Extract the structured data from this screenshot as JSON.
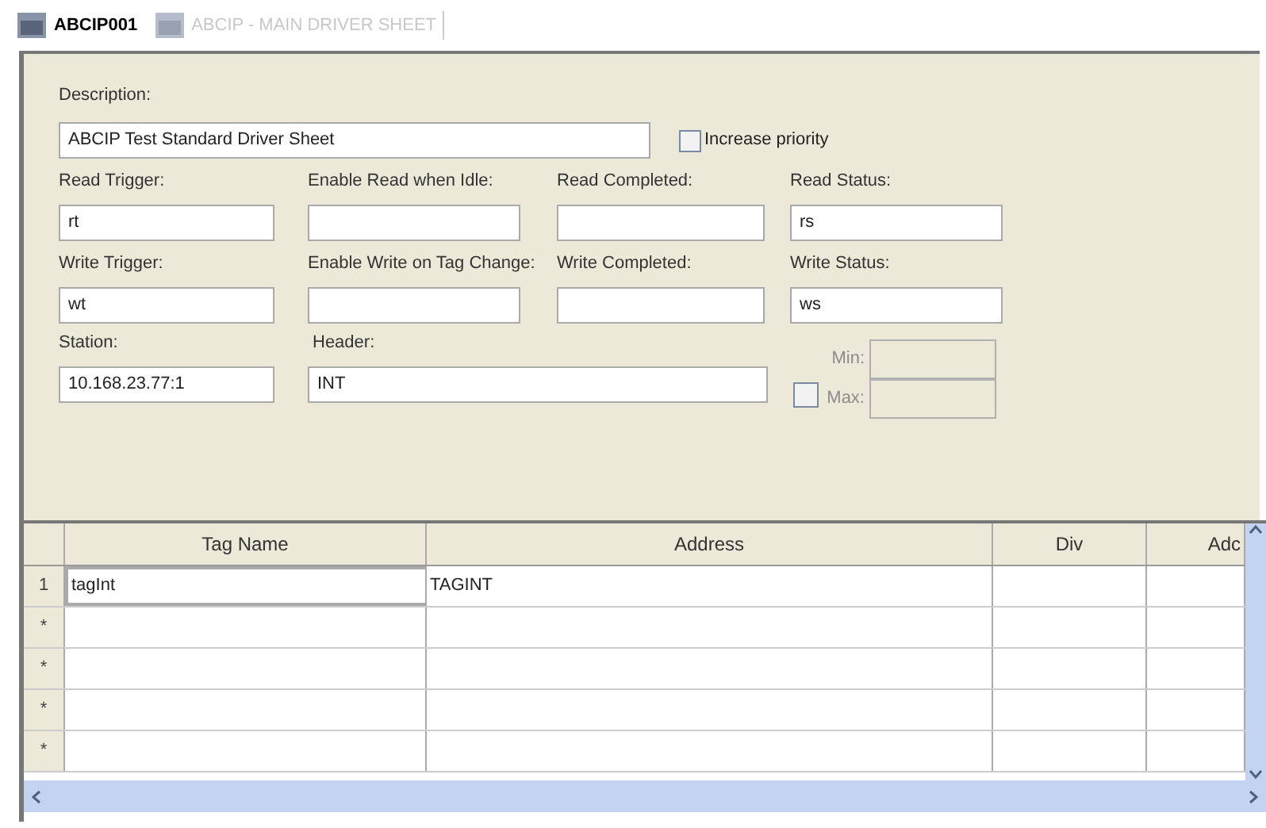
{
  "tabs": [
    {
      "label": "ABCIP001",
      "selected": true
    },
    {
      "label": "ABCIP - MAIN DRIVER SHEET",
      "selected": false
    }
  ],
  "description": {
    "label": "Description:",
    "value": "ABCIP Test Standard Driver Sheet"
  },
  "increase_priority": {
    "label": "Increase priority",
    "checked": false
  },
  "field_rows": [
    [
      {
        "label": "Read Trigger:",
        "value": "rt"
      },
      {
        "label": "Enable Read when Idle:"
      },
      {
        "label": "Read Completed:"
      },
      {
        "label": "Read Status:",
        "value": "rs"
      }
    ],
    [
      {
        "label": "Write Trigger:",
        "value": "wt"
      },
      {
        "label": "Enable Write on Tag Change:"
      },
      {
        "label": "Write Completed:"
      },
      {
        "label": "Write Status:",
        "value": "ws"
      }
    ]
  ],
  "station": {
    "label": "Station:",
    "value": "10.168.23.77:1"
  },
  "header": {
    "label": "Header:",
    "value": "INT"
  },
  "range": {
    "checked": false,
    "disabled": true,
    "min_label": "Min:",
    "max_label": "Max:"
  },
  "grid": {
    "columns": [
      "Tag Name",
      "Address",
      "Div",
      "Adc"
    ],
    "rows": [
      {
        "header": "1",
        "cells": [
          {
            "text": "tagInt",
            "focused": true
          },
          {
            "text": "TAGINT",
            "focused": false
          }
        ]
      },
      {
        "header": "*",
        "cells": []
      },
      {
        "header": "*",
        "cells": []
      },
      {
        "header": "*",
        "cells": []
      },
      {
        "header": "*",
        "cells": []
      }
    ]
  }
}
